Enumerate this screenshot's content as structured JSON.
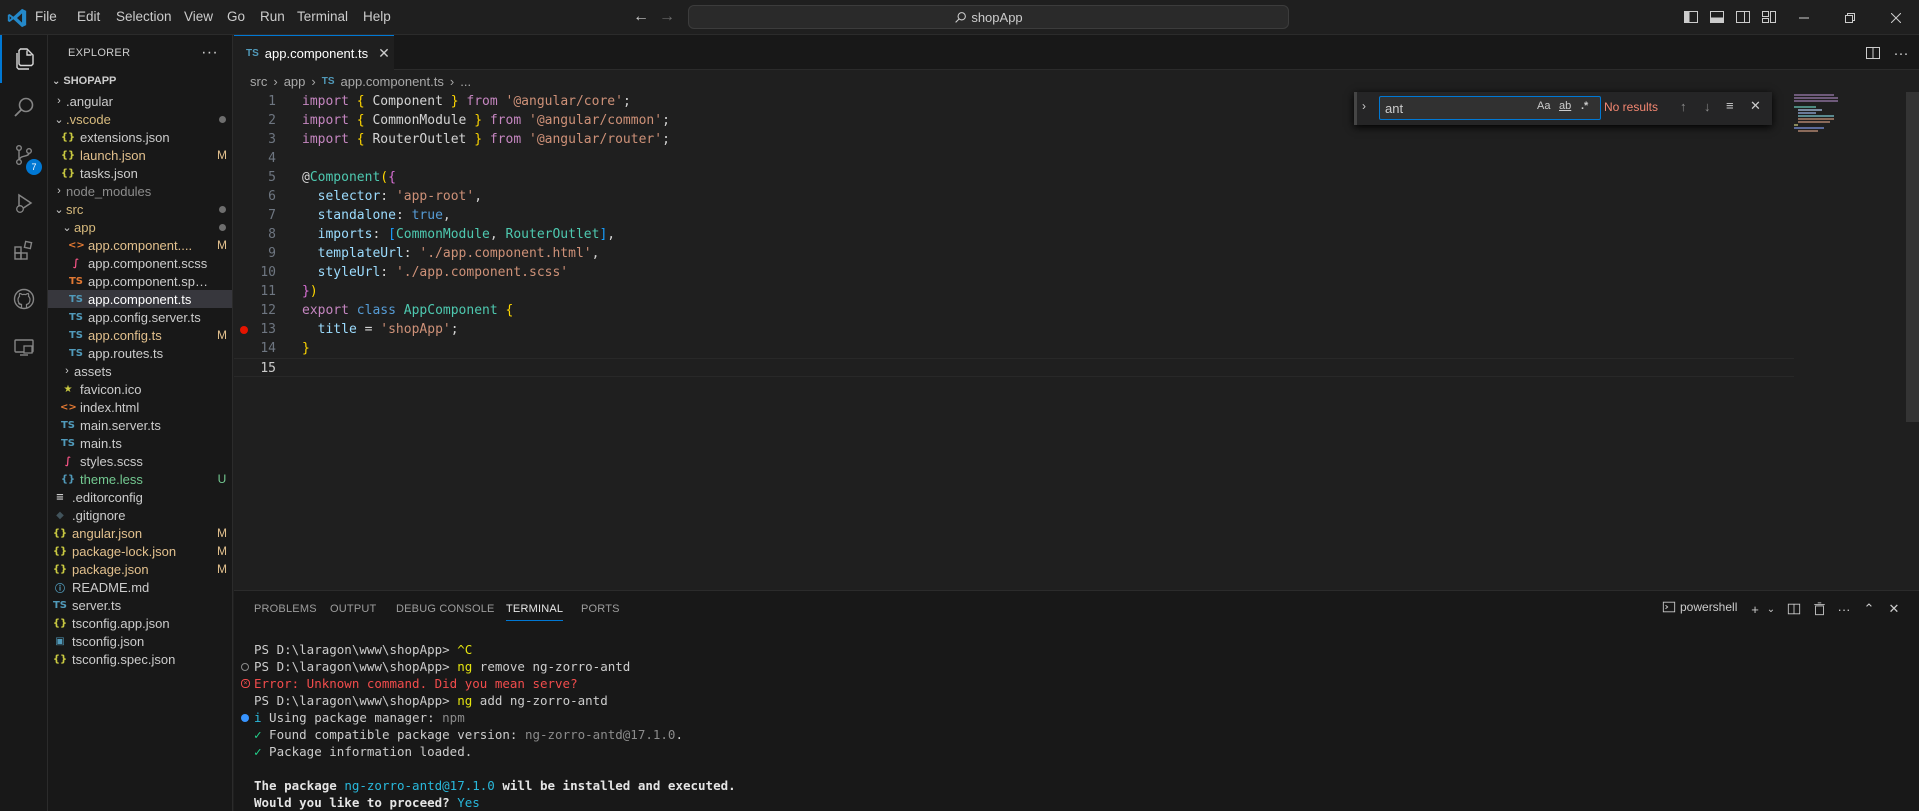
{
  "titlebar": {
    "menu": [
      "File",
      "Edit",
      "Selection",
      "View",
      "Go",
      "Run",
      "Terminal",
      "Help"
    ],
    "search": "shopApp"
  },
  "activity": {
    "source_control_badge": "7"
  },
  "explorer": {
    "header": "EXPLORER",
    "folder": "SHOPAPP",
    "items": [
      {
        "name": ".angular",
        "kind": "folder",
        "open": false,
        "depth": 1,
        "status": "",
        "color": "#cccccc"
      },
      {
        "name": ".vscode",
        "kind": "folder",
        "open": true,
        "depth": 1,
        "status": "dot",
        "color": "#d7ba7d"
      },
      {
        "name": "extensions.json",
        "kind": "json",
        "depth": 2,
        "status": "",
        "color": "#cccccc"
      },
      {
        "name": "launch.json",
        "kind": "json",
        "depth": 2,
        "status": "M",
        "color": "#e2c08d"
      },
      {
        "name": "tasks.json",
        "kind": "json",
        "depth": 2,
        "status": "",
        "color": "#cccccc"
      },
      {
        "name": "node_modules",
        "kind": "folder",
        "open": false,
        "depth": 1,
        "status": "",
        "color": "#8c8c8c"
      },
      {
        "name": "src",
        "kind": "folder",
        "open": true,
        "depth": 1,
        "status": "dot",
        "color": "#d7ba7d"
      },
      {
        "name": "app",
        "kind": "folder",
        "open": true,
        "depth": 2,
        "status": "dot",
        "color": "#d7ba7d"
      },
      {
        "name": "app.component....",
        "kind": "html",
        "depth": 3,
        "status": "M",
        "color": "#e2c08d"
      },
      {
        "name": "app.component.scss",
        "kind": "scss",
        "depth": 3,
        "status": "",
        "color": "#cccccc"
      },
      {
        "name": "app.component.spec.ts",
        "kind": "spec",
        "depth": 3,
        "status": "",
        "color": "#cccccc"
      },
      {
        "name": "app.component.ts",
        "kind": "ts",
        "depth": 3,
        "status": "",
        "color": "#ffffff",
        "selected": true
      },
      {
        "name": "app.config.server.ts",
        "kind": "ts",
        "depth": 3,
        "status": "",
        "color": "#cccccc"
      },
      {
        "name": "app.config.ts",
        "kind": "ts",
        "depth": 3,
        "status": "M",
        "color": "#e2c08d"
      },
      {
        "name": "app.routes.ts",
        "kind": "ts",
        "depth": 3,
        "status": "",
        "color": "#cccccc"
      },
      {
        "name": "assets",
        "kind": "folder",
        "open": false,
        "depth": 2,
        "status": "",
        "color": "#cccccc"
      },
      {
        "name": "favicon.ico",
        "kind": "ico",
        "depth": 2,
        "status": "",
        "color": "#cccccc"
      },
      {
        "name": "index.html",
        "kind": "html",
        "depth": 2,
        "status": "",
        "color": "#cccccc"
      },
      {
        "name": "main.server.ts",
        "kind": "ts",
        "depth": 2,
        "status": "",
        "color": "#cccccc"
      },
      {
        "name": "main.ts",
        "kind": "ts",
        "depth": 2,
        "status": "",
        "color": "#cccccc"
      },
      {
        "name": "styles.scss",
        "kind": "scss",
        "depth": 2,
        "status": "",
        "color": "#cccccc"
      },
      {
        "name": "theme.less",
        "kind": "less",
        "depth": 2,
        "status": "U",
        "color": "#73c991"
      },
      {
        "name": ".editorconfig",
        "kind": "cfg",
        "depth": 1,
        "status": "",
        "color": "#cccccc"
      },
      {
        "name": ".gitignore",
        "kind": "git",
        "depth": 1,
        "status": "",
        "color": "#cccccc"
      },
      {
        "name": "angular.json",
        "kind": "json",
        "depth": 1,
        "status": "M",
        "color": "#e2c08d"
      },
      {
        "name": "package-lock.json",
        "kind": "json",
        "depth": 1,
        "status": "M",
        "color": "#e2c08d"
      },
      {
        "name": "package.json",
        "kind": "json",
        "depth": 1,
        "status": "M",
        "color": "#e2c08d"
      },
      {
        "name": "README.md",
        "kind": "md",
        "depth": 1,
        "status": "",
        "color": "#cccccc"
      },
      {
        "name": "server.ts",
        "kind": "ts",
        "depth": 1,
        "status": "",
        "color": "#cccccc"
      },
      {
        "name": "tsconfig.app.json",
        "kind": "json",
        "depth": 1,
        "status": "",
        "color": "#cccccc"
      },
      {
        "name": "tsconfig.json",
        "kind": "tsconfig",
        "depth": 1,
        "status": "",
        "color": "#cccccc"
      },
      {
        "name": "tsconfig.spec.json",
        "kind": "json",
        "depth": 1,
        "status": "",
        "color": "#cccccc"
      }
    ]
  },
  "editor": {
    "tab_label": "app.component.ts",
    "tab_icon": "TS",
    "breadcrumb": [
      "src",
      "app",
      "app.component.ts",
      "..."
    ],
    "current_line": 15,
    "breakpoint_line": 13,
    "find": {
      "query": "ant",
      "result": "No results",
      "opt_case": "Aa",
      "opt_word": "ab",
      "opt_regex": ".*"
    }
  },
  "code_lines": [
    [
      [
        "kw",
        "import "
      ],
      [
        "br",
        "{ "
      ],
      [
        "pl",
        "Component "
      ],
      [
        "br",
        "}"
      ],
      [
        "kw",
        " from "
      ],
      [
        "str",
        "'@angular/core'"
      ],
      [
        "pl",
        ";"
      ]
    ],
    [
      [
        "kw",
        "import "
      ],
      [
        "br",
        "{ "
      ],
      [
        "pl",
        "CommonModule "
      ],
      [
        "br",
        "}"
      ],
      [
        "kw",
        " from "
      ],
      [
        "str",
        "'@angular/common'"
      ],
      [
        "pl",
        ";"
      ]
    ],
    [
      [
        "kw",
        "import "
      ],
      [
        "br",
        "{ "
      ],
      [
        "pl",
        "RouterOutlet "
      ],
      [
        "br",
        "}"
      ],
      [
        "kw",
        " from "
      ],
      [
        "str",
        "'@angular/router'"
      ],
      [
        "pl",
        ";"
      ]
    ],
    [],
    [
      [
        "pl",
        "@"
      ],
      [
        "ty",
        "Component"
      ],
      [
        "br",
        "("
      ],
      [
        "br2",
        "{"
      ]
    ],
    [
      [
        "pl",
        "  "
      ],
      [
        "prop",
        "selector"
      ],
      [
        "pl",
        ": "
      ],
      [
        "str",
        "'app-root'"
      ],
      [
        "pl",
        ","
      ]
    ],
    [
      [
        "pl",
        "  "
      ],
      [
        "prop",
        "standalone"
      ],
      [
        "pl",
        ": "
      ],
      [
        "kw2",
        "true"
      ],
      [
        "pl",
        ","
      ]
    ],
    [
      [
        "pl",
        "  "
      ],
      [
        "prop",
        "imports"
      ],
      [
        "pl",
        ": "
      ],
      [
        "br3",
        "["
      ],
      [
        "ty",
        "CommonModule"
      ],
      [
        "pl",
        ", "
      ],
      [
        "ty",
        "RouterOutlet"
      ],
      [
        "br3",
        "]"
      ],
      [
        "pl",
        ","
      ]
    ],
    [
      [
        "pl",
        "  "
      ],
      [
        "prop",
        "templateUrl"
      ],
      [
        "pl",
        ": "
      ],
      [
        "str",
        "'./app.component.html'"
      ],
      [
        "pl",
        ","
      ]
    ],
    [
      [
        "pl",
        "  "
      ],
      [
        "prop",
        "styleUrl"
      ],
      [
        "pl",
        ": "
      ],
      [
        "str",
        "'./app.component.scss'"
      ]
    ],
    [
      [
        "br2",
        "}"
      ],
      [
        "br",
        ")"
      ]
    ],
    [
      [
        "kw",
        "export "
      ],
      [
        "kw2",
        "class "
      ],
      [
        "ty",
        "AppComponent "
      ],
      [
        "br",
        "{"
      ]
    ],
    [
      [
        "pl",
        "  "
      ],
      [
        "prop",
        "title"
      ],
      [
        "pl",
        " = "
      ],
      [
        "str",
        "'shopApp'"
      ],
      [
        "pl",
        ";"
      ]
    ],
    [
      [
        "br",
        "}"
      ]
    ],
    []
  ],
  "panel": {
    "tabs": [
      "PROBLEMS",
      "OUTPUT",
      "DEBUG CONSOLE",
      "TERMINAL",
      "PORTS"
    ],
    "active_tab": "TERMINAL",
    "shell": "powershell"
  },
  "terminal_lines": [
    {
      "deco": "",
      "parts": [
        [
          "",
          "PS D:\\laragon\\www\\shopApp> "
        ],
        [
          "yellow",
          "^C"
        ]
      ]
    },
    {
      "deco": "ring",
      "parts": [
        [
          "",
          "PS D:\\laragon\\www\\shopApp> "
        ],
        [
          "yellow",
          "ng"
        ],
        [
          "",
          " remove ng-zorro-antd"
        ]
      ]
    },
    {
      "deco": "error",
      "parts": [
        [
          "red",
          "Error: Unknown command. Did you mean serve?"
        ]
      ]
    },
    {
      "deco": "",
      "parts": [
        [
          "",
          "PS D:\\laragon\\www\\shopApp> "
        ],
        [
          "yellow",
          "ng"
        ],
        [
          "",
          " add ng-zorro-antd"
        ]
      ]
    },
    {
      "deco": "blue",
      "parts": [
        [
          "cyan",
          "i"
        ],
        [
          "",
          " Using package manager: "
        ],
        [
          "gray",
          "npm"
        ]
      ]
    },
    {
      "deco": "",
      "parts": [
        [
          "green",
          "✓"
        ],
        [
          "",
          " Found compatible package version: "
        ],
        [
          "gray",
          "ng-zorro-antd@17.1.0"
        ],
        [
          "",
          "."
        ]
      ]
    },
    {
      "deco": "",
      "parts": [
        [
          "green",
          "✓"
        ],
        [
          "",
          " Package information loaded."
        ]
      ]
    },
    {
      "deco": "",
      "parts": []
    },
    {
      "deco": "",
      "parts": [
        [
          "bold",
          "The package "
        ],
        [
          "cyan",
          "ng-zorro-antd@17.1.0"
        ],
        [
          "bold",
          " will be installed and executed."
        ]
      ]
    },
    {
      "deco": "",
      "parts": [
        [
          "bold",
          "Would you like to proceed? "
        ],
        [
          "cyan",
          "Yes"
        ]
      ]
    }
  ]
}
